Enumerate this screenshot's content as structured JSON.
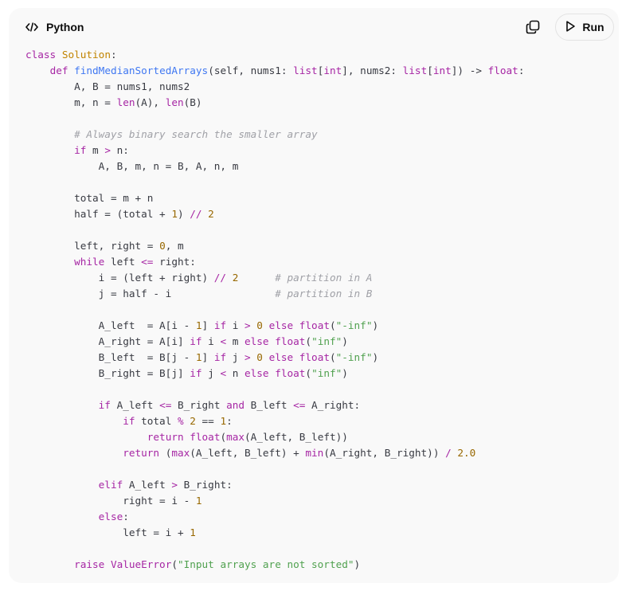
{
  "header": {
    "language": "Python",
    "copy_icon": "copy-icon",
    "run_label": "Run",
    "run_icon": "play-icon",
    "code_icon": "code-icon"
  },
  "code": {
    "lines": [
      [
        [
          "kw",
          "class"
        ],
        [
          "id",
          " "
        ],
        [
          "cls",
          "Solution"
        ],
        [
          "id",
          ":"
        ]
      ],
      [
        [
          "id",
          "    "
        ],
        [
          "kw",
          "def"
        ],
        [
          "id",
          " "
        ],
        [
          "fn",
          "findMedianSortedArrays"
        ],
        [
          "id",
          "(self, nums1: "
        ],
        [
          "bi",
          "list"
        ],
        [
          "id",
          "["
        ],
        [
          "bi",
          "int"
        ],
        [
          "id",
          "], nums2: "
        ],
        [
          "bi",
          "list"
        ],
        [
          "id",
          "["
        ],
        [
          "bi",
          "int"
        ],
        [
          "id",
          "]) -> "
        ],
        [
          "bi",
          "float"
        ],
        [
          "id",
          ":"
        ]
      ],
      [
        [
          "id",
          "        A, B = nums1, nums2"
        ]
      ],
      [
        [
          "id",
          "        m, n = "
        ],
        [
          "bi",
          "len"
        ],
        [
          "id",
          "(A), "
        ],
        [
          "bi",
          "len"
        ],
        [
          "id",
          "(B)"
        ]
      ],
      [
        [
          "id",
          ""
        ]
      ],
      [
        [
          "id",
          "        "
        ],
        [
          "com",
          "# Always binary search the smaller array"
        ]
      ],
      [
        [
          "id",
          "        "
        ],
        [
          "kw",
          "if"
        ],
        [
          "id",
          " m "
        ],
        [
          "op",
          ">"
        ],
        [
          "id",
          " n:"
        ]
      ],
      [
        [
          "id",
          "            A, B, m, n = B, A, n, m"
        ]
      ],
      [
        [
          "id",
          ""
        ]
      ],
      [
        [
          "id",
          "        total = m + n"
        ]
      ],
      [
        [
          "id",
          "        half = (total + "
        ],
        [
          "num",
          "1"
        ],
        [
          "id",
          ") "
        ],
        [
          "op",
          "//"
        ],
        [
          "id",
          " "
        ],
        [
          "num",
          "2"
        ]
      ],
      [
        [
          "id",
          ""
        ]
      ],
      [
        [
          "id",
          "        left, right = "
        ],
        [
          "num",
          "0"
        ],
        [
          "id",
          ", m"
        ]
      ],
      [
        [
          "id",
          "        "
        ],
        [
          "kw",
          "while"
        ],
        [
          "id",
          " left "
        ],
        [
          "op",
          "<="
        ],
        [
          "id",
          " right:"
        ]
      ],
      [
        [
          "id",
          "            i = (left + right) "
        ],
        [
          "op",
          "//"
        ],
        [
          "id",
          " "
        ],
        [
          "num",
          "2"
        ],
        [
          "id",
          "      "
        ],
        [
          "com",
          "# partition in A"
        ]
      ],
      [
        [
          "id",
          "            j = half - i                 "
        ],
        [
          "com",
          "# partition in B"
        ]
      ],
      [
        [
          "id",
          ""
        ]
      ],
      [
        [
          "id",
          "            A_left  = A[i - "
        ],
        [
          "num",
          "1"
        ],
        [
          "id",
          "] "
        ],
        [
          "kw",
          "if"
        ],
        [
          "id",
          " i "
        ],
        [
          "op",
          ">"
        ],
        [
          "id",
          " "
        ],
        [
          "num",
          "0"
        ],
        [
          "id",
          " "
        ],
        [
          "kw",
          "else"
        ],
        [
          "id",
          " "
        ],
        [
          "bi",
          "float"
        ],
        [
          "id",
          "("
        ],
        [
          "str",
          "\"-inf\""
        ],
        [
          "id",
          ")"
        ]
      ],
      [
        [
          "id",
          "            A_right = A[i] "
        ],
        [
          "kw",
          "if"
        ],
        [
          "id",
          " i "
        ],
        [
          "op",
          "<"
        ],
        [
          "id",
          " m "
        ],
        [
          "kw",
          "else"
        ],
        [
          "id",
          " "
        ],
        [
          "bi",
          "float"
        ],
        [
          "id",
          "("
        ],
        [
          "str",
          "\"inf\""
        ],
        [
          "id",
          ")"
        ]
      ],
      [
        [
          "id",
          "            B_left  = B[j - "
        ],
        [
          "num",
          "1"
        ],
        [
          "id",
          "] "
        ],
        [
          "kw",
          "if"
        ],
        [
          "id",
          " j "
        ],
        [
          "op",
          ">"
        ],
        [
          "id",
          " "
        ],
        [
          "num",
          "0"
        ],
        [
          "id",
          " "
        ],
        [
          "kw",
          "else"
        ],
        [
          "id",
          " "
        ],
        [
          "bi",
          "float"
        ],
        [
          "id",
          "("
        ],
        [
          "str",
          "\"-inf\""
        ],
        [
          "id",
          ")"
        ]
      ],
      [
        [
          "id",
          "            B_right = B[j] "
        ],
        [
          "kw",
          "if"
        ],
        [
          "id",
          " j "
        ],
        [
          "op",
          "<"
        ],
        [
          "id",
          " n "
        ],
        [
          "kw",
          "else"
        ],
        [
          "id",
          " "
        ],
        [
          "bi",
          "float"
        ],
        [
          "id",
          "("
        ],
        [
          "str",
          "\"inf\""
        ],
        [
          "id",
          ")"
        ]
      ],
      [
        [
          "id",
          ""
        ]
      ],
      [
        [
          "id",
          "            "
        ],
        [
          "kw",
          "if"
        ],
        [
          "id",
          " A_left "
        ],
        [
          "op",
          "<="
        ],
        [
          "id",
          " B_right "
        ],
        [
          "kw",
          "and"
        ],
        [
          "id",
          " B_left "
        ],
        [
          "op",
          "<="
        ],
        [
          "id",
          " A_right:"
        ]
      ],
      [
        [
          "id",
          "                "
        ],
        [
          "kw",
          "if"
        ],
        [
          "id",
          " total "
        ],
        [
          "op",
          "%"
        ],
        [
          "id",
          " "
        ],
        [
          "num",
          "2"
        ],
        [
          "id",
          " == "
        ],
        [
          "num",
          "1"
        ],
        [
          "id",
          ":"
        ]
      ],
      [
        [
          "id",
          "                    "
        ],
        [
          "kw",
          "return"
        ],
        [
          "id",
          " "
        ],
        [
          "bi",
          "float"
        ],
        [
          "id",
          "("
        ],
        [
          "bi",
          "max"
        ],
        [
          "id",
          "(A_left, B_left))"
        ]
      ],
      [
        [
          "id",
          "                "
        ],
        [
          "kw",
          "return"
        ],
        [
          "id",
          " ("
        ],
        [
          "bi",
          "max"
        ],
        [
          "id",
          "(A_left, B_left) + "
        ],
        [
          "bi",
          "min"
        ],
        [
          "id",
          "(A_right, B_right)) "
        ],
        [
          "op",
          "/"
        ],
        [
          "id",
          " "
        ],
        [
          "num",
          "2.0"
        ]
      ],
      [
        [
          "id",
          ""
        ]
      ],
      [
        [
          "id",
          "            "
        ],
        [
          "kw",
          "elif"
        ],
        [
          "id",
          " A_left "
        ],
        [
          "op",
          ">"
        ],
        [
          "id",
          " B_right:"
        ]
      ],
      [
        [
          "id",
          "                right = i - "
        ],
        [
          "num",
          "1"
        ]
      ],
      [
        [
          "id",
          "            "
        ],
        [
          "kw",
          "else"
        ],
        [
          "id",
          ":"
        ]
      ],
      [
        [
          "id",
          "                left = i + "
        ],
        [
          "num",
          "1"
        ]
      ],
      [
        [
          "id",
          ""
        ]
      ],
      [
        [
          "id",
          "        "
        ],
        [
          "kw",
          "raise"
        ],
        [
          "id",
          " "
        ],
        [
          "bi",
          "ValueError"
        ],
        [
          "id",
          "("
        ],
        [
          "str",
          "\"Input arrays are not sorted\""
        ],
        [
          "id",
          ")"
        ]
      ]
    ]
  },
  "colors": {
    "keyword": "#a626a4",
    "class_name": "#c18401",
    "function_name": "#4078f2",
    "string": "#50a14f",
    "number": "#986801",
    "comment": "#a0a1a7",
    "text": "#383a42",
    "card_background": "#f9f9f9"
  }
}
